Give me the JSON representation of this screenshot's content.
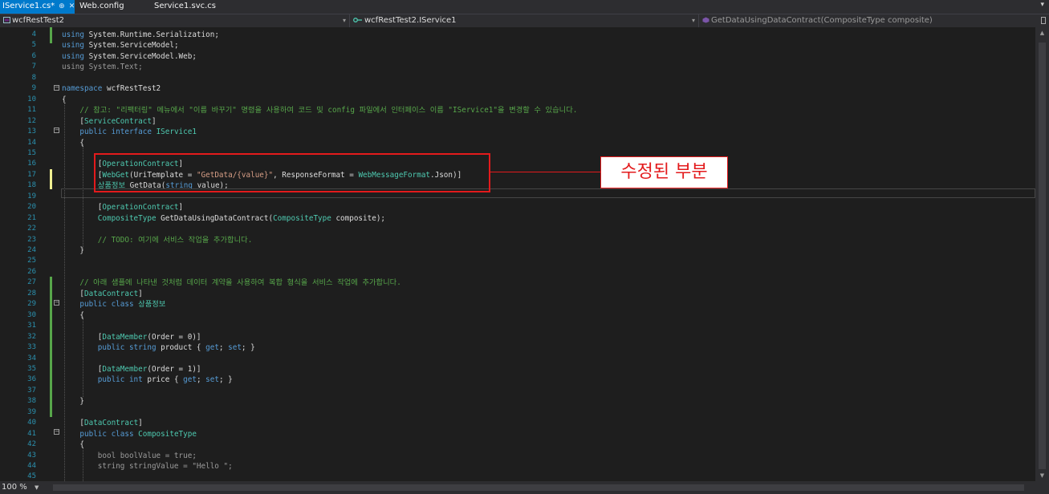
{
  "tabs": [
    {
      "label": "IService1.cs*",
      "active": true
    },
    {
      "label": "Web.config",
      "active": false
    },
    {
      "label": "Service1.svc.cs",
      "active": false
    }
  ],
  "tab_icons": {
    "pin": "⊕",
    "close": "✕",
    "overflow": "▾"
  },
  "nav": {
    "project": "wcfRestTest2",
    "type": "wcfRestTest2.IService1",
    "member": "GetDataUsingDataContract(CompositeType composite)"
  },
  "editor": {
    "lines": [
      {
        "n": "4",
        "tokens": [
          [
            "kw",
            "using"
          ],
          [
            "p",
            " System.Runtime.Serialization;"
          ]
        ]
      },
      {
        "n": "5",
        "tokens": [
          [
            "kw",
            "using"
          ],
          [
            "p",
            " System.ServiceModel;"
          ]
        ]
      },
      {
        "n": "6",
        "tokens": [
          [
            "kw",
            "using"
          ],
          [
            "p",
            " System.ServiceModel.Web;"
          ]
        ]
      },
      {
        "n": "7",
        "tokens": [
          [
            "dim",
            "using System.Text;"
          ]
        ]
      },
      {
        "n": "8",
        "tokens": []
      },
      {
        "n": "9",
        "tokens": [
          [
            "kw",
            "namespace"
          ],
          [
            "p",
            " wcfRestTest2"
          ]
        ]
      },
      {
        "n": "10",
        "tokens": [
          [
            "p",
            "{"
          ]
        ]
      },
      {
        "n": "11",
        "tokens": [
          [
            "p",
            "    "
          ],
          [
            "cm",
            "// 참고: \"리팩터링\" 메뉴에서 \"이름 바꾸기\" 명령을 사용하여 코드 및 config 파일에서 인터페이스 이름 \"IService1\"을 변경할 수 있습니다."
          ]
        ]
      },
      {
        "n": "12",
        "tokens": [
          [
            "p",
            "    ["
          ],
          [
            "ty",
            "ServiceContract"
          ],
          [
            "p",
            "]"
          ]
        ]
      },
      {
        "n": "13",
        "tokens": [
          [
            "p",
            "    "
          ],
          [
            "kw",
            "public interface"
          ],
          [
            "p",
            " "
          ],
          [
            "ty",
            "IService1"
          ]
        ]
      },
      {
        "n": "14",
        "tokens": [
          [
            "p",
            "    {"
          ]
        ]
      },
      {
        "n": "15",
        "tokens": []
      },
      {
        "n": "16",
        "tokens": [
          [
            "p",
            "        ["
          ],
          [
            "ty",
            "OperationContract"
          ],
          [
            "p",
            "]"
          ]
        ]
      },
      {
        "n": "17",
        "tokens": [
          [
            "p",
            "        ["
          ],
          [
            "ty",
            "WebGet"
          ],
          [
            "p",
            "(UriTemplate = "
          ],
          [
            "st",
            "\"GetData/{value}\""
          ],
          [
            "p",
            ", ResponseFormat = "
          ],
          [
            "ty",
            "WebMessageFormat"
          ],
          [
            "p",
            ".Json)]"
          ]
        ]
      },
      {
        "n": "18",
        "tokens": [
          [
            "p",
            "        "
          ],
          [
            "ty",
            "상품정보"
          ],
          [
            "p",
            " GetData("
          ],
          [
            "kw",
            "string"
          ],
          [
            "p",
            " value);"
          ]
        ]
      },
      {
        "n": "19",
        "tokens": []
      },
      {
        "n": "20",
        "tokens": [
          [
            "p",
            "        ["
          ],
          [
            "ty",
            "OperationContract"
          ],
          [
            "p",
            "]"
          ]
        ]
      },
      {
        "n": "21",
        "tokens": [
          [
            "p",
            "        "
          ],
          [
            "ty",
            "CompositeType"
          ],
          [
            "p",
            " GetDataUsingDataContract("
          ],
          [
            "ty",
            "CompositeType"
          ],
          [
            "p",
            " composite);"
          ]
        ]
      },
      {
        "n": "22",
        "tokens": []
      },
      {
        "n": "23",
        "tokens": [
          [
            "p",
            "        "
          ],
          [
            "cm",
            "// TODO: 여기에 서비스 작업을 추가합니다."
          ]
        ]
      },
      {
        "n": "24",
        "tokens": [
          [
            "p",
            "    }"
          ]
        ]
      },
      {
        "n": "25",
        "tokens": []
      },
      {
        "n": "26",
        "tokens": []
      },
      {
        "n": "27",
        "tokens": [
          [
            "p",
            "    "
          ],
          [
            "cm",
            "// 아래 샘플에 나타낸 것처럼 데이터 계약을 사용하여 복합 형식을 서비스 작업에 추가합니다."
          ]
        ]
      },
      {
        "n": "28",
        "tokens": [
          [
            "p",
            "    ["
          ],
          [
            "ty",
            "DataContract"
          ],
          [
            "p",
            "]"
          ]
        ]
      },
      {
        "n": "29",
        "tokens": [
          [
            "p",
            "    "
          ],
          [
            "kw",
            "public class"
          ],
          [
            "p",
            " "
          ],
          [
            "ty",
            "상품정보"
          ]
        ]
      },
      {
        "n": "30",
        "tokens": [
          [
            "p",
            "    {"
          ]
        ]
      },
      {
        "n": "31",
        "tokens": []
      },
      {
        "n": "32",
        "tokens": [
          [
            "p",
            "        ["
          ],
          [
            "ty",
            "DataMember"
          ],
          [
            "p",
            "(Order = 0)]"
          ]
        ]
      },
      {
        "n": "33",
        "tokens": [
          [
            "p",
            "        "
          ],
          [
            "kw",
            "public string"
          ],
          [
            "p",
            " product { "
          ],
          [
            "kw",
            "get"
          ],
          [
            "p",
            "; "
          ],
          [
            "kw",
            "set"
          ],
          [
            "p",
            "; }"
          ]
        ]
      },
      {
        "n": "34",
        "tokens": []
      },
      {
        "n": "35",
        "tokens": [
          [
            "p",
            "        ["
          ],
          [
            "ty",
            "DataMember"
          ],
          [
            "p",
            "(Order = 1)]"
          ]
        ]
      },
      {
        "n": "36",
        "tokens": [
          [
            "p",
            "        "
          ],
          [
            "kw",
            "public int"
          ],
          [
            "p",
            " price { "
          ],
          [
            "kw",
            "get"
          ],
          [
            "p",
            "; "
          ],
          [
            "kw",
            "set"
          ],
          [
            "p",
            "; }"
          ]
        ]
      },
      {
        "n": "37",
        "tokens": []
      },
      {
        "n": "38",
        "tokens": [
          [
            "p",
            "    }"
          ]
        ]
      },
      {
        "n": "39",
        "tokens": []
      },
      {
        "n": "40",
        "tokens": [
          [
            "p",
            "    ["
          ],
          [
            "ty",
            "DataContract"
          ],
          [
            "p",
            "]"
          ]
        ]
      },
      {
        "n": "41",
        "tokens": [
          [
            "p",
            "    "
          ],
          [
            "kw",
            "public class"
          ],
          [
            "p",
            " "
          ],
          [
            "ty",
            "CompositeType"
          ]
        ]
      },
      {
        "n": "42",
        "tokens": [
          [
            "p",
            "    {"
          ]
        ]
      },
      {
        "n": "43",
        "tokens": [
          [
            "p",
            "        "
          ],
          [
            "dim",
            "bool boolValue = true;"
          ]
        ]
      },
      {
        "n": "44",
        "tokens": [
          [
            "p",
            "        "
          ],
          [
            "dim",
            "string stringValue = \"Hello \";"
          ]
        ]
      },
      {
        "n": "45",
        "tokens": []
      }
    ]
  },
  "annotation": {
    "label": "수정된 부분"
  },
  "status": {
    "zoom": "100 %"
  },
  "colors": {
    "accent": "#007acc",
    "annotation": "#e31a1c",
    "background": "#1e1e1e"
  }
}
